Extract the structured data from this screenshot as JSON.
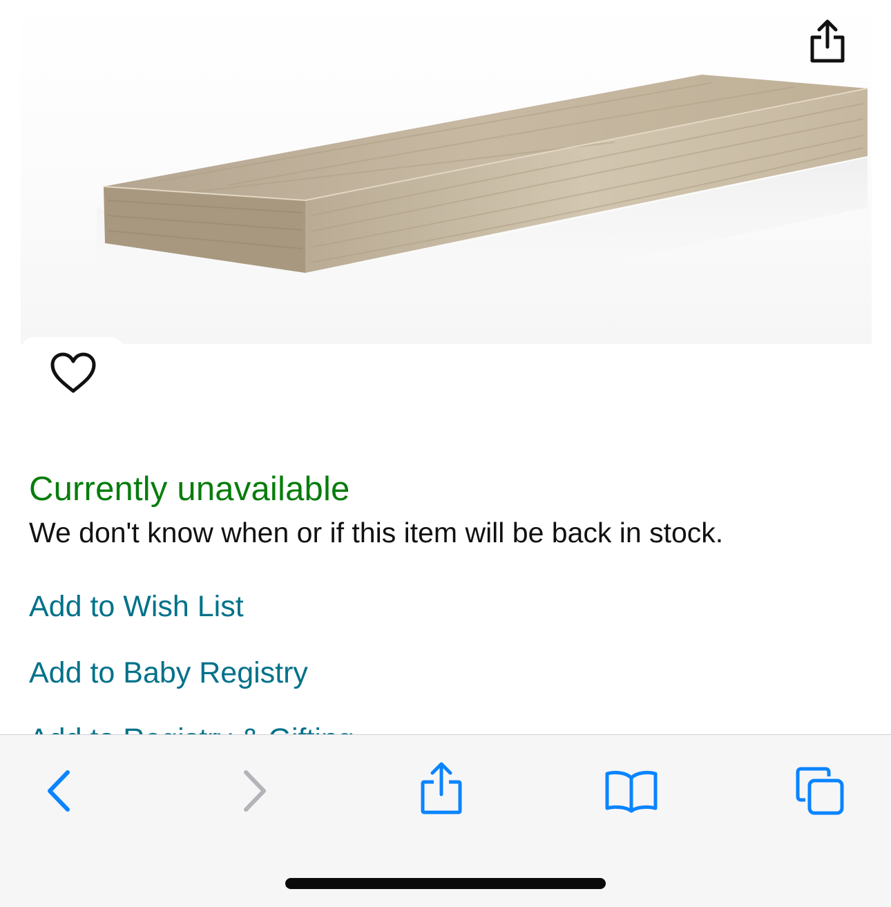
{
  "product": {
    "image_alt": "Floating wood shelf",
    "share_icon": "share-icon",
    "favorite_icon": "heart-outline-icon"
  },
  "availability": {
    "status": "Currently unavailable",
    "message": "We don't know when or if this item will be back in stock.",
    "status_color": "#067d0b"
  },
  "actions": {
    "wish_list": "Add to Wish List",
    "baby_registry": "Add to Baby Registry",
    "registry_gifting": "Add to Registry & Gifting",
    "link_color": "#00718a"
  },
  "toolbar": {
    "back_icon": "chevron-left-icon",
    "forward_icon": "chevron-right-icon",
    "share_icon": "share-icon",
    "bookmarks_icon": "book-icon",
    "tabs_icon": "tabs-icon",
    "accent_color": "#0a84ff",
    "disabled_color": "#b3b3b8"
  }
}
